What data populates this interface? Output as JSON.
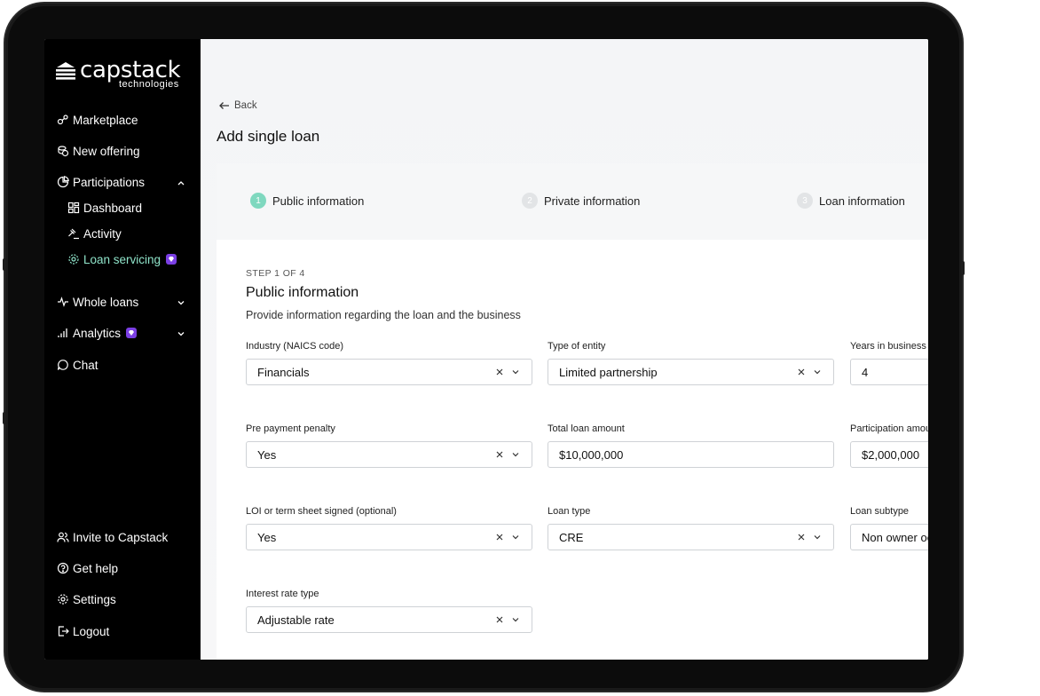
{
  "brand": {
    "name": "capstack",
    "tagline": "technologies"
  },
  "sidebar": {
    "items": [
      {
        "label": "Marketplace",
        "icon": "marketplace-icon"
      },
      {
        "label": "New offering",
        "icon": "coins-icon"
      },
      {
        "label": "Participations",
        "icon": "pie-chart-icon"
      },
      {
        "label": "Dashboard",
        "icon": "dashboard-icon"
      },
      {
        "label": "Activity",
        "icon": "gavel-icon"
      },
      {
        "label": "Loan servicing",
        "icon": "gear-icon"
      },
      {
        "label": "Whole loans",
        "icon": "pulse-icon"
      },
      {
        "label": "Analytics",
        "icon": "bar-signal-icon"
      },
      {
        "label": "Chat",
        "icon": "chat-icon"
      }
    ],
    "bottom": [
      {
        "label": "Invite to Capstack",
        "icon": "users-icon"
      },
      {
        "label": "Get help",
        "icon": "help-icon"
      },
      {
        "label": "Settings",
        "icon": "gear-icon"
      },
      {
        "label": "Logout",
        "icon": "logout-icon"
      }
    ],
    "accent": "#8fe3c9",
    "premium_color": "#7b3fe4"
  },
  "header": {
    "back_label": "Back",
    "title": "Add single loan"
  },
  "stepper": {
    "steps": [
      {
        "number": "1",
        "label": "Public information"
      },
      {
        "number": "2",
        "label": "Private information"
      },
      {
        "number": "3",
        "label": "Loan information"
      }
    ]
  },
  "form": {
    "step_label": "STEP 1 OF 4",
    "title": "Public information",
    "description": "Provide information regarding the loan and the business",
    "fields": {
      "industry": {
        "label": "Industry (NAICS code)",
        "value": "Financials"
      },
      "entity": {
        "label": "Type of entity",
        "value": "Limited partnership"
      },
      "years": {
        "label": "Years in business",
        "value": "4"
      },
      "prepay": {
        "label": "Pre payment penalty",
        "value": "Yes"
      },
      "total": {
        "label": "Total loan amount",
        "value": "$10,000,000"
      },
      "participation": {
        "label": "Participation amou",
        "value": "$2,000,000"
      },
      "loi": {
        "label": "LOI or term sheet signed (optional)",
        "value": "Yes"
      },
      "loan_type": {
        "label": "Loan type",
        "value": "CRE"
      },
      "subtype": {
        "label": "Loan subtype",
        "value": "Non owner oc"
      },
      "rate": {
        "label": "Interest rate type",
        "value": "Adjustable rate"
      }
    }
  }
}
